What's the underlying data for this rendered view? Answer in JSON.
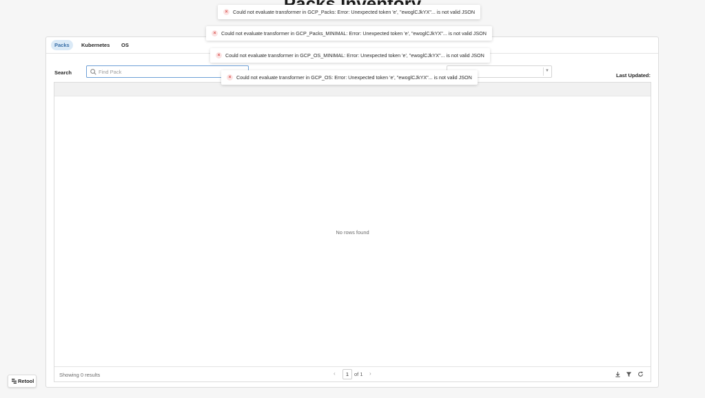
{
  "page": {
    "title": "Packs Inventory"
  },
  "tabs": [
    {
      "label": "Packs",
      "active": true
    },
    {
      "label": "Kubernetes",
      "active": false
    },
    {
      "label": "OS",
      "active": false
    }
  ],
  "search": {
    "label": "Search",
    "placeholder": "Find Pack",
    "value": ""
  },
  "filter_select": {
    "value": ""
  },
  "last_updated": {
    "label": "Last Updated:"
  },
  "table": {
    "empty_message": "No rows found",
    "footer": {
      "showing": "Showing 0 results",
      "page_current": "1",
      "page_of": "of 1"
    }
  },
  "toasts": [
    {
      "message": "Could not evaluate transformer in GCP_Packs: Error: Unexpected token 'e', \"ewoglCJkYX\"... is not valid JSON"
    },
    {
      "message": "Could not evaluate transformer in GCP_Packs_MINIMAL: Error: Unexpected token 'e', \"ewoglCJkYX\"... is not valid JSON"
    },
    {
      "message": "Could not evaluate transformer in GCP_OS_MINIMAL: Error: Unexpected token 'e', \"ewoglCJkYX\"... is not valid JSON"
    },
    {
      "message": "Could not evaluate transformer in GCP_OS: Error: Unexpected token 'e', \"ewoglCJkYX\"... is not valid JSON"
    }
  ],
  "branding": {
    "label": "Retool"
  },
  "icons": {
    "search": "search-icon",
    "select_chevron": "chevron-down-icon",
    "prev": "chevron-left-icon",
    "next": "chevron-right-icon",
    "download": "download-icon",
    "filter": "filter-icon",
    "refresh": "refresh-icon",
    "toast_error": "error-x-icon",
    "retool": "retool-logo-icon"
  },
  "colors": {
    "active_tab_bg": "#dbeaf7",
    "active_tab_text": "#3a6fa7",
    "search_border": "#6d9fd6",
    "error_icon": "#d9534f"
  }
}
